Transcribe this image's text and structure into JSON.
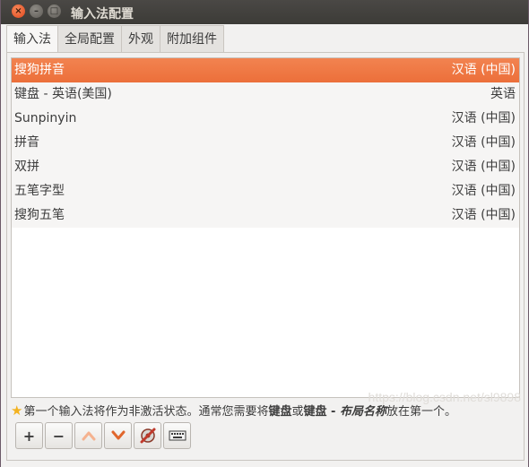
{
  "window": {
    "title": "输入法配置"
  },
  "titlebar_buttons": {
    "close": "×",
    "minimize": "–",
    "maximize": "□"
  },
  "tabs": [
    {
      "label": "输入法",
      "active": true
    },
    {
      "label": "全局配置",
      "active": false
    },
    {
      "label": "外观",
      "active": false
    },
    {
      "label": "附加组件",
      "active": false
    }
  ],
  "input_methods": [
    {
      "name": "搜狗拼音",
      "lang": "汉语 (中国)",
      "selected": true
    },
    {
      "name": "键盘 - 英语(美国)",
      "lang": "英语",
      "selected": false
    },
    {
      "name": "Sunpinyin",
      "lang": "汉语 (中国)",
      "selected": false
    },
    {
      "name": "拼音",
      "lang": "汉语 (中国)",
      "selected": false
    },
    {
      "name": "双拼",
      "lang": "汉语 (中国)",
      "selected": false
    },
    {
      "name": "五笔字型",
      "lang": "汉语 (中国)",
      "selected": false
    },
    {
      "name": "搜狗五笔",
      "lang": "汉语 (中国)",
      "selected": false
    }
  ],
  "hint": {
    "part1": "第一个输入法将作为非激活状态。通常您需要将",
    "bold1": "键盘",
    "part2": "或",
    "bold2": "键盘 - ",
    "bolditalic": "布局名称",
    "part3": "放在第一个。"
  },
  "toolbar": {
    "add_label": "+",
    "remove_label": "−",
    "up_icon": "chevron-up-icon",
    "down_icon": "chevron-down-icon",
    "configure_icon": "settings-icon",
    "keyboard_icon": "keyboard-icon"
  },
  "watermark": "https://blog.csdn.net/sl9898",
  "colors": {
    "selection": "#f07746",
    "titlebar": "#3c3b37",
    "accent": "#e0662c"
  }
}
